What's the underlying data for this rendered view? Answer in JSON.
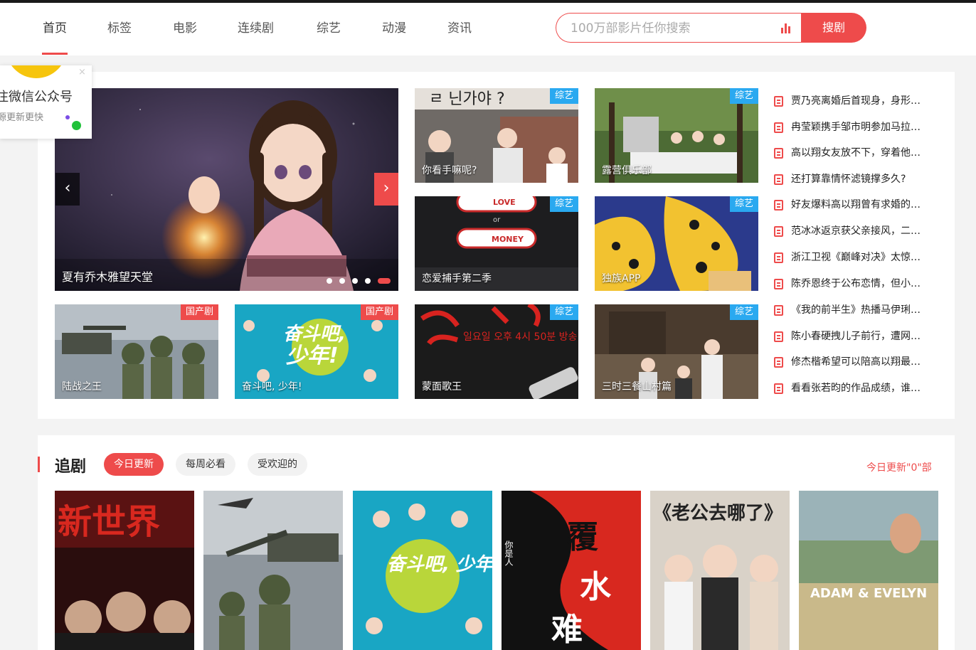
{
  "nav": {
    "items": [
      "首页",
      "标签",
      "电影",
      "连续剧",
      "综艺",
      "动漫",
      "资讯"
    ],
    "active_index": 0
  },
  "search": {
    "placeholder": "100万部影片任你搜索",
    "button_label": "搜剧"
  },
  "popup": {
    "title": "注微信公众号",
    "subtitle": "源更新更快",
    "close_label": "×"
  },
  "hero": {
    "caption": "夏有乔木雅望天堂",
    "prev_label": "‹",
    "next_label": "›",
    "slide_count": 5,
    "active_slide": 4
  },
  "tiles": [
    {
      "caption": "你看手嘛呢?",
      "tag": "综艺"
    },
    {
      "caption": "露营俱乐部",
      "tag": "综艺"
    },
    {
      "caption": "恋爱捕手第二季",
      "tag": "综艺"
    },
    {
      "caption": "独族APP",
      "tag": "综艺"
    },
    {
      "caption": "陆战之王",
      "tag": "国产剧"
    },
    {
      "caption": "奋斗吧, 少年!",
      "tag": "国产剧"
    },
    {
      "caption": "蒙面歌王",
      "tag": "综艺"
    },
    {
      "caption": "三时三餐山村篇",
      "tag": "综艺"
    }
  ],
  "news": [
    "贾乃亮离婚后首现身，身形…",
    "冉莹颖携手邹市明参加马拉…",
    "高以翔女友放不下，穿着他…",
    "还打算靠情怀滤镜撑多久?",
    "好友爆料高以翔曾有求婚的…",
    "范冰冰返京获父亲接风，二…",
    "浙江卫视《巅峰对决》太惊…",
    "陈乔恩终于公布恋情，但小…",
    "《我的前半生》热播马伊琍…",
    "陈小春硬拽儿子前行，遭网…",
    "修杰楷希望可以陪高以翔最…",
    "看看张若昀的作品成绩，谁…"
  ],
  "section": {
    "title": "追剧",
    "tabs": [
      "今日更新",
      "每周必看",
      "受欢迎的"
    ],
    "active_tab": 0,
    "today_count": "今日更新\"0\"部"
  },
  "posters": [
    {
      "title_art": "新世界"
    },
    {
      "title_art": ""
    },
    {
      "title_art": "奋斗吧, 少年!"
    },
    {
      "title_art": "覆水难收"
    },
    {
      "title_art": "《老公去哪了》"
    },
    {
      "title_art": "ADAM & EVELYN"
    }
  ],
  "colors": {
    "accent": "#ee4b4b",
    "tag_blue": "#2aa9f0"
  }
}
